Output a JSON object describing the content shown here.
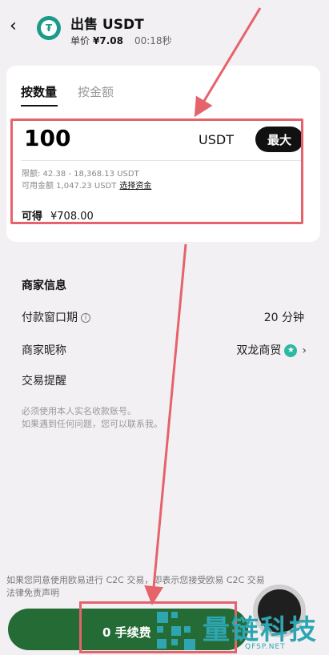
{
  "header": {
    "back_icon": "chevron-left-icon",
    "coin_icon": "usdt-coin-icon",
    "title": "出售 USDT",
    "price_label": "单价",
    "price_value": "¥7.08",
    "timer": "00:18秒"
  },
  "tabs": [
    {
      "label": "按数量",
      "active": true
    },
    {
      "label": "按金额",
      "active": false
    }
  ],
  "input": {
    "amount": "100",
    "unit": "USDT",
    "max_label": "最大",
    "limit_text": "限额: 42.38 - 18,368.13 USDT",
    "available_text": "可用金额 1,047.23 USDT",
    "select_funds_label": "选择资金",
    "receive_label": "可得",
    "receive_value": "¥708.00"
  },
  "merchant": {
    "section_title": "商家信息",
    "payment_window_label": "付款窗口期",
    "payment_window_value": "20 分钟",
    "nickname_label": "商家昵称",
    "nickname_value": "双龙商贸",
    "reminder_label": "交易提醒",
    "note_line1": "必须使用本人实名收款账号。",
    "note_line2": "如果遇到任何问题，您可以联系我。"
  },
  "agreement": {
    "line1": "如果您同意使用欧易进行 C2C 交易，即表示您接受欧易 C2C 交易",
    "line2": "法律免责声明"
  },
  "footer": {
    "sell_button_label": "0 手续费"
  },
  "watermark": {
    "brand": "量链科技",
    "domain": "QFSP.NET"
  },
  "colors": {
    "accent_red": "#e5636b",
    "sell_green": "#246b35",
    "watermark": "#2ea6b2"
  }
}
